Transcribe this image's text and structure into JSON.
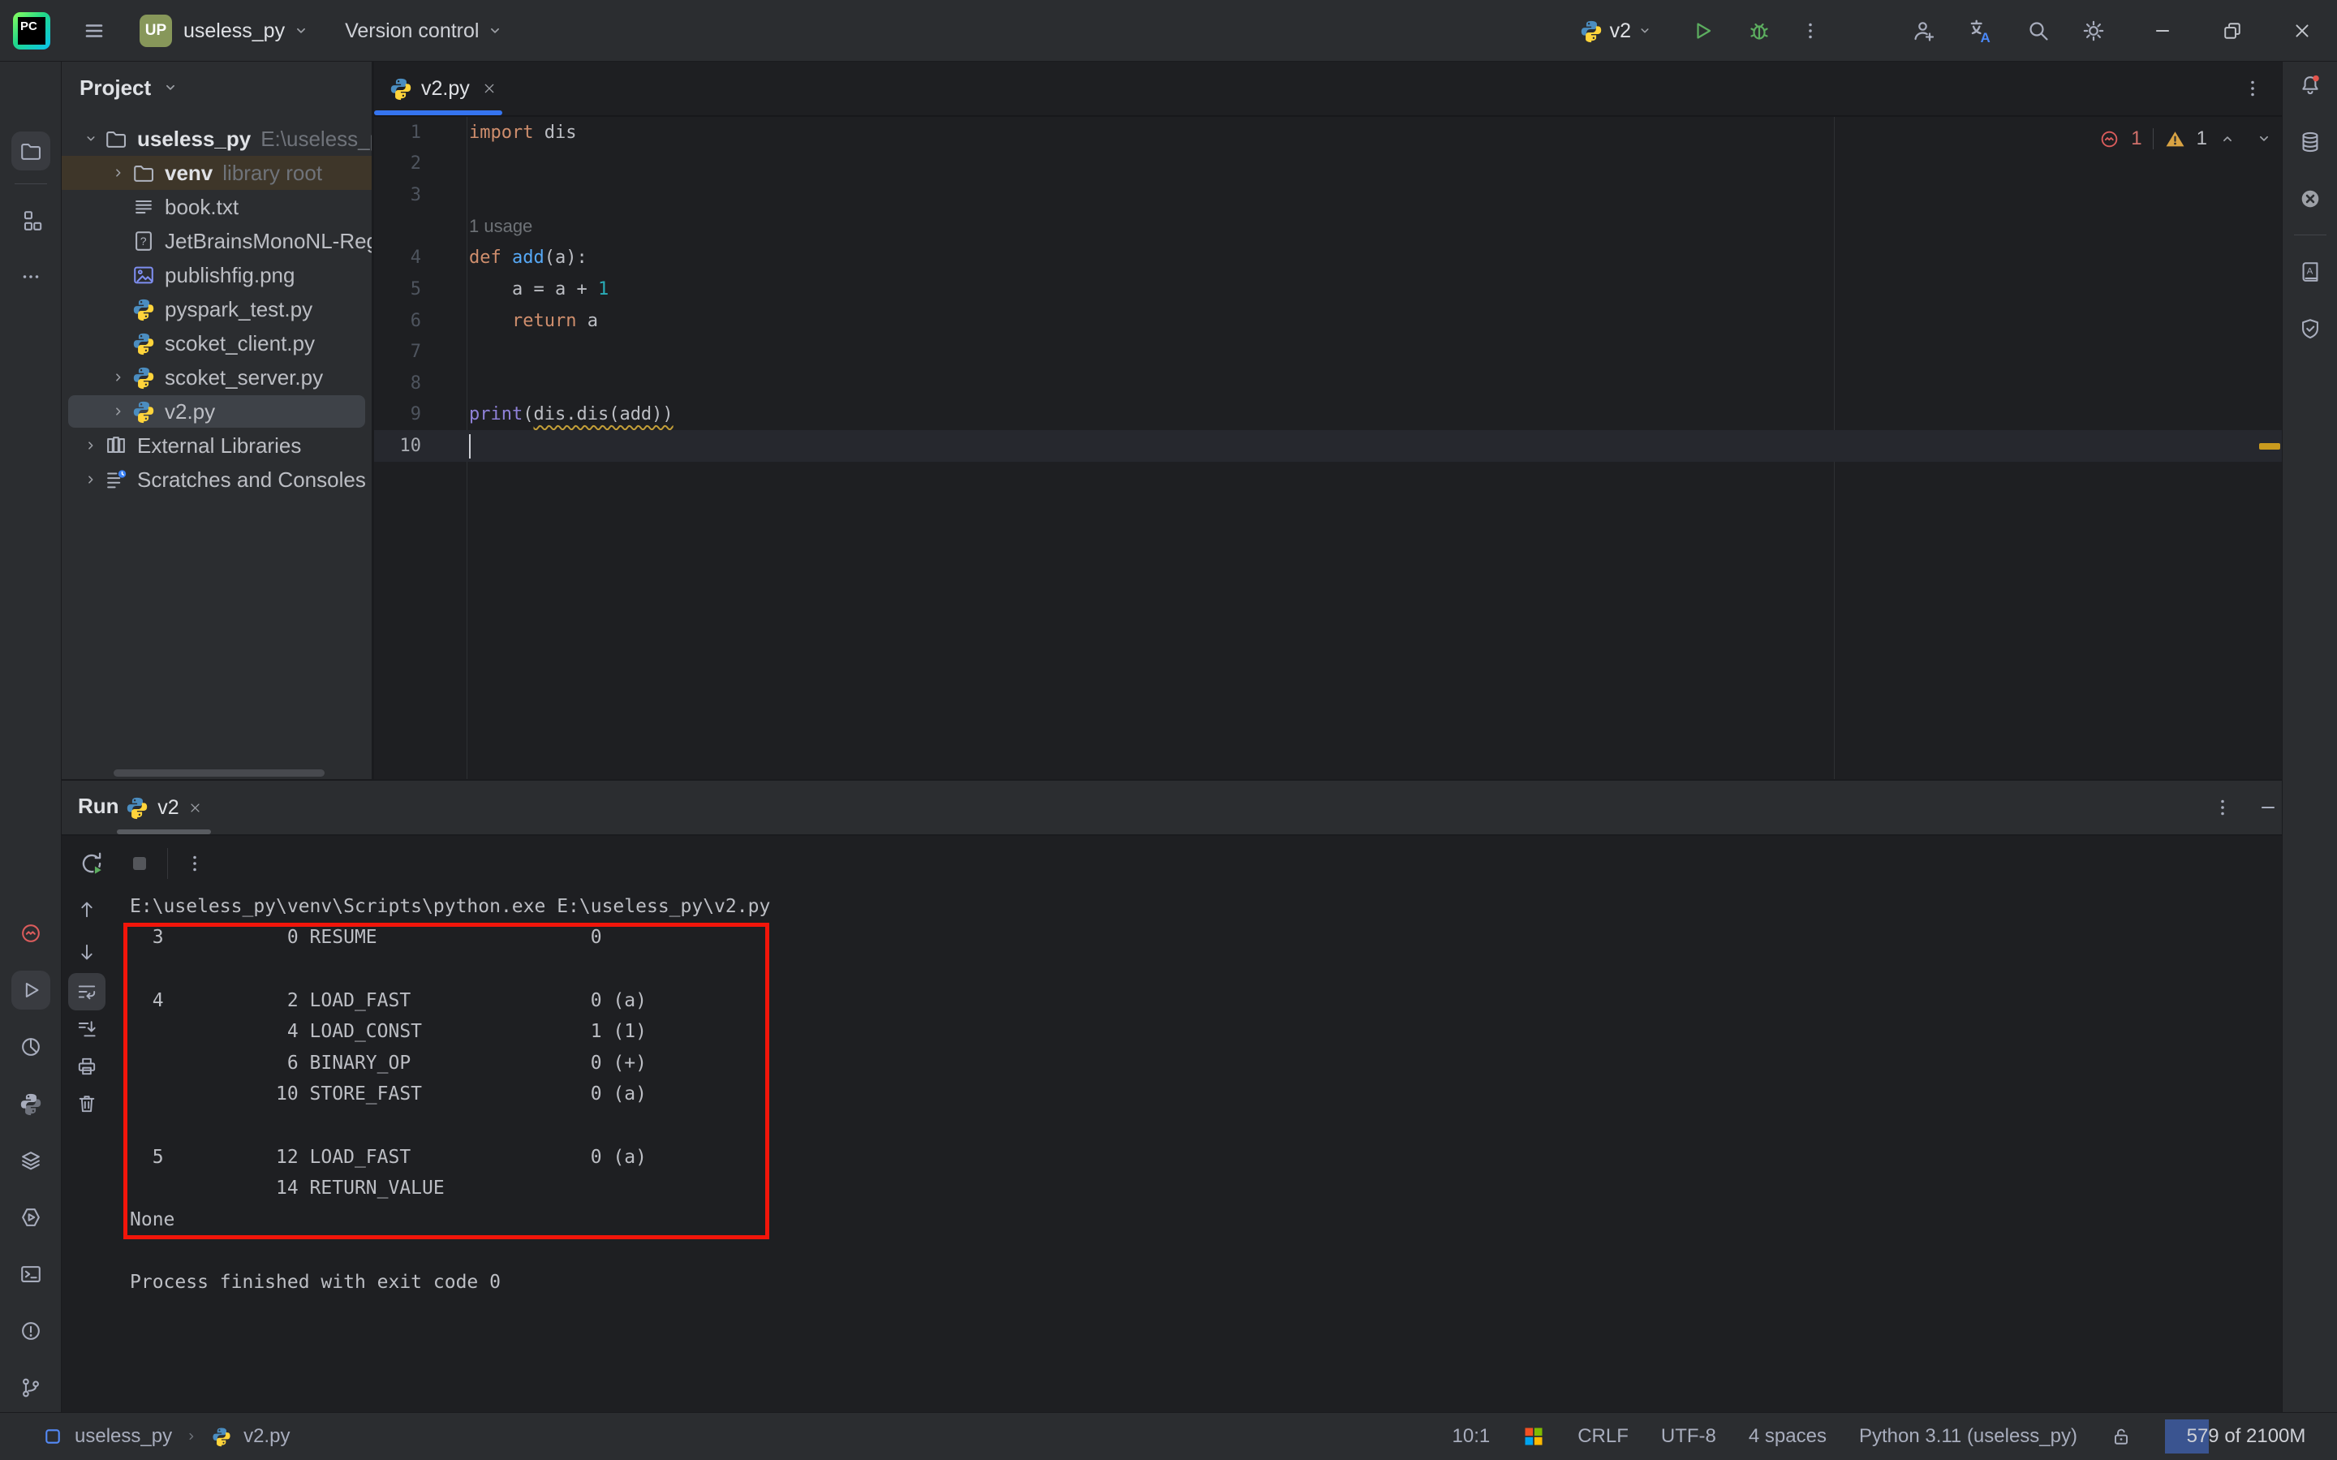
{
  "colors": {
    "accent_blue": "#3574F0",
    "annotation_red": "#F2150A",
    "warning_yellow": "#D9A343",
    "error_red": "#DB5C5C",
    "run_green": "#5CAD5F",
    "python_blue": "#4B8DC0",
    "python_yellow": "#FFD43B"
  },
  "titlebar": {
    "logo_text": "PC",
    "project_badge": "UP",
    "project_name": "useless_py",
    "vcs_label": "Version control",
    "run_config": "v2"
  },
  "left_strip": {
    "top": [
      {
        "icon": "folder-icon",
        "name": "tool-project",
        "active": true
      },
      {
        "sep": true
      },
      {
        "icon": "structure-icon",
        "name": "tool-structure"
      },
      {
        "icon": "more-icon",
        "name": "more-tool-windows"
      }
    ],
    "bottom": [
      {
        "icon": "errors-icon",
        "name": "tool-errors",
        "color": "#DB5C5C"
      },
      {
        "icon": "run-outline-icon",
        "name": "tool-run",
        "active": true
      },
      {
        "icon": "profiler-icon",
        "name": "tool-profiler"
      },
      {
        "icon": "python-mono-icon",
        "name": "tool-python-console"
      },
      {
        "icon": "services-icon",
        "name": "tool-services"
      },
      {
        "icon": "packages-icon",
        "name": "tool-python-packages"
      },
      {
        "icon": "terminal-icon",
        "name": "tool-terminal"
      },
      {
        "icon": "problems-icon",
        "name": "tool-problems"
      },
      {
        "icon": "git-branch-icon",
        "name": "tool-version-control"
      }
    ]
  },
  "right_strip": [
    {
      "icon": "bell-icon",
      "name": "notifications",
      "badge": true
    },
    {
      "icon": "database-icon",
      "name": "tool-database"
    },
    {
      "icon": "sciview-icon",
      "name": "tool-sciview"
    },
    {
      "sep": true
    },
    {
      "icon": "dictionary-icon",
      "name": "tool-documentation"
    },
    {
      "icon": "shield-icon",
      "name": "tool-coverage"
    }
  ],
  "project_panel": {
    "header": "Project",
    "tree": [
      {
        "indent": 0,
        "chevron": "down",
        "icon": "folder-icon",
        "label": "useless_py",
        "bold": true,
        "suffix": "E:\\useless_py",
        "name": "tree-useless_py"
      },
      {
        "indent": 1,
        "chevron": "right",
        "icon": "folder-icon",
        "label": "venv",
        "bold": true,
        "suffix": "library root",
        "highlight": "library",
        "name": "tree-venv"
      },
      {
        "indent": 1,
        "icon": "text-file-icon",
        "label": "book.txt",
        "name": "tree-book-txt"
      },
      {
        "indent": 1,
        "icon": "unknown-file-icon",
        "label": "JetBrainsMonoNL-Regula",
        "name": "tree-jetbrains-font"
      },
      {
        "indent": 1,
        "icon": "image-file-icon",
        "label": "publishfig.png",
        "name": "tree-publishfig"
      },
      {
        "indent": 1,
        "icon": "python-icon",
        "label": "pyspark_test.py",
        "name": "tree-pyspark-test"
      },
      {
        "indent": 1,
        "icon": "python-icon",
        "label": "scoket_client.py",
        "name": "tree-scoket-client"
      },
      {
        "indent": 1,
        "chevron": "right",
        "icon": "python-icon",
        "label": "scoket_server.py",
        "name": "tree-scoket-server"
      },
      {
        "indent": 1,
        "chevron": "right",
        "icon": "python-icon",
        "label": "v2.py",
        "selected": true,
        "name": "tree-v2-py"
      },
      {
        "indent": 0,
        "chevron": "right",
        "icon": "library-icon",
        "label": "External Libraries",
        "name": "tree-external-libraries"
      },
      {
        "indent": 0,
        "chevron": "right",
        "icon": "scratches-icon",
        "label": "Scratches and Consoles",
        "name": "tree-scratches"
      }
    ]
  },
  "editor": {
    "tab_label": "v2.py",
    "inspections": {
      "errors": "1",
      "warnings": "1"
    },
    "lines": [
      {
        "num": "1",
        "segments": [
          {
            "text": "import ",
            "style": "keyword"
          },
          {
            "text": "dis",
            "style": "plain"
          }
        ]
      },
      {
        "num": "2",
        "segments": []
      },
      {
        "num": "3",
        "segments": []
      },
      {
        "inlay": "1 usage"
      },
      {
        "num": "4",
        "segments": [
          {
            "text": "def ",
            "style": "keyword"
          },
          {
            "text": "add",
            "style": "function"
          },
          {
            "text": "(a):",
            "style": "plain"
          }
        ]
      },
      {
        "num": "5",
        "segments": [
          {
            "text": "    a = a + ",
            "style": "plain"
          },
          {
            "text": "1",
            "style": "number"
          }
        ]
      },
      {
        "num": "6",
        "segments": [
          {
            "text": "    ",
            "style": "plain"
          },
          {
            "text": "return",
            "style": "keyword"
          },
          {
            "text": " a",
            "style": "plain"
          }
        ]
      },
      {
        "num": "7",
        "segments": []
      },
      {
        "num": "8",
        "segments": []
      },
      {
        "num": "9",
        "segments": [
          {
            "text": "print",
            "style": "builtin"
          },
          {
            "text": "(",
            "style": "plain"
          },
          {
            "text": "dis.dis(add))",
            "style": "weak-warning"
          }
        ]
      },
      {
        "num": "10",
        "segments": [],
        "current": true
      }
    ],
    "caret_position": "10:1"
  },
  "run_panel": {
    "title": "Run",
    "tab_label": "v2",
    "console_lines": [
      "E:\\useless_py\\venv\\Scripts\\python.exe E:\\useless_py\\v2.py",
      "  3           0 RESUME                   0",
      "",
      "  4           2 LOAD_FAST                0 (a)",
      "              4 LOAD_CONST               1 (1)",
      "              6 BINARY_OP                0 (+)",
      "             10 STORE_FAST               0 (a)",
      "",
      "  5          12 LOAD_FAST                0 (a)",
      "             14 RETURN_VALUE",
      "None",
      "",
      "Process finished with exit code 0"
    ],
    "annotation_box": {
      "present": true,
      "color": "#F2150A"
    },
    "left_toolbar": [
      {
        "icon": "arrow-up-icon",
        "name": "prev-occurrence"
      },
      {
        "icon": "arrow-down-icon",
        "name": "next-occurrence"
      },
      {
        "icon": "softwrap-icon",
        "name": "soft-wrap",
        "active": true
      },
      {
        "icon": "scroll-end-icon",
        "name": "scroll-to-end"
      },
      {
        "icon": "print-icon",
        "name": "print-output"
      },
      {
        "icon": "trash-icon",
        "name": "clear-output"
      }
    ]
  },
  "statusbar": {
    "breadcrumbs": [
      {
        "label": "useless_py"
      },
      {
        "label": "v2.py"
      }
    ],
    "items": [
      {
        "label": "10:1",
        "name": "caret-position"
      },
      {
        "icon": "windows-logo-icon",
        "name": "os-indicator"
      },
      {
        "label": "CRLF",
        "name": "line-separator"
      },
      {
        "label": "UTF-8",
        "name": "file-encoding"
      },
      {
        "label": "4 spaces",
        "name": "indent-style"
      },
      {
        "label": "Python 3.11 (useless_py)",
        "name": "python-interpreter"
      },
      {
        "icon": "unlocked-padlock-icon",
        "name": "read-write-status"
      }
    ],
    "memory": {
      "label": "579 of 2100M",
      "fill_pct": 27
    }
  }
}
